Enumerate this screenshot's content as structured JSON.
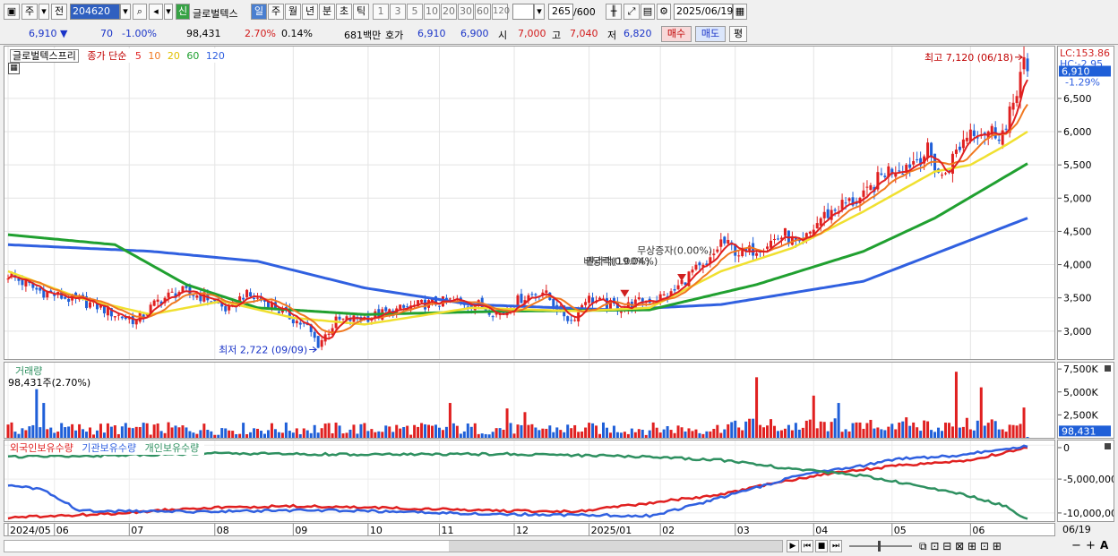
{
  "toolbar": {
    "market": "주",
    "market_prefix": "전",
    "code": "204620",
    "new_badge": "신",
    "stock_name": "글로벌텍스",
    "periods": [
      "일",
      "주",
      "월",
      "년",
      "분",
      "초",
      "틱"
    ],
    "active_period": "일",
    "intervals": [
      "1",
      "3",
      "5",
      "10",
      "20",
      "30",
      "60",
      "120"
    ],
    "count": "265",
    "count_total": "/600",
    "date": "2025/06/19"
  },
  "quote": {
    "price": "6,910",
    "arrow": "▼",
    "change": "70",
    "change_pct": "-1.00%",
    "volume": "98,431",
    "volume_pct": "2.70%",
    "turnover_pct": "0.14%",
    "amount": "681백만",
    "hoga_label": "호가",
    "ask": "6,910",
    "bid": "6,900",
    "open_label": "시",
    "open": "7,000",
    "high_label": "고",
    "high": "7,040",
    "low_label": "저",
    "low": "6,820",
    "buy_label": "매수",
    "sell_label": "매도",
    "eval_label": "평"
  },
  "chart_data": [
    {
      "type": "candlestick",
      "title": "글로벌텍스프리",
      "legend": {
        "price_type": "종가 단순",
        "ma_periods": [
          "5",
          "10",
          "20",
          "60",
          "120"
        ]
      },
      "colors": {
        "up": "#e02020",
        "down": "#1f5fd8",
        "ma5": "#e02020",
        "ma10": "#f07820",
        "ma20": "#f0e030",
        "ma60": "#20a030",
        "ma120": "#3060e0"
      },
      "x_tick_labels": [
        "2024/05",
        "06",
        "07",
        "08",
        "09",
        "10",
        "11",
        "12",
        "2025/01",
        "02",
        "03",
        "04",
        "05",
        "06"
      ],
      "x_end_label": "06/19",
      "y_ticks": [
        3000,
        3500,
        4000,
        4500,
        5000,
        5500,
        6000,
        6500
      ],
      "y_tick_labels": [
        "3,000",
        "3,500",
        "4,000",
        "4,500",
        "5,000",
        "5,500",
        "6,000",
        "6,500"
      ],
      "ylim": [
        2580,
        7280
      ],
      "right_labels": {
        "lc": "LC:153.86",
        "hc": "HC:-2.95",
        "current": "6,910",
        "current_pct": "-1.29%"
      },
      "annotations": {
        "max": "최고 7,120 (06/18)",
        "min": "최저 2,722 (09/09)",
        "events": [
          "배당락(0.00%)",
          "권리락(19.04%)",
          "무상증자(0.00%)"
        ]
      },
      "close_keypoints": [
        {
          "x": 0,
          "y": 3850
        },
        {
          "x": 8,
          "y": 3620
        },
        {
          "x": 16,
          "y": 3500
        },
        {
          "x": 24,
          "y": 3400
        },
        {
          "x": 30,
          "y": 3250
        },
        {
          "x": 36,
          "y": 3150
        },
        {
          "x": 42,
          "y": 3450
        },
        {
          "x": 48,
          "y": 3600
        },
        {
          "x": 56,
          "y": 3500
        },
        {
          "x": 62,
          "y": 3300
        },
        {
          "x": 66,
          "y": 3550
        },
        {
          "x": 72,
          "y": 3450
        },
        {
          "x": 78,
          "y": 3250
        },
        {
          "x": 84,
          "y": 3050
        },
        {
          "x": 87,
          "y": 2800
        },
        {
          "x": 92,
          "y": 3150
        },
        {
          "x": 100,
          "y": 3200
        },
        {
          "x": 108,
          "y": 3300
        },
        {
          "x": 116,
          "y": 3400
        },
        {
          "x": 124,
          "y": 3450
        },
        {
          "x": 132,
          "y": 3400
        },
        {
          "x": 138,
          "y": 3250
        },
        {
          "x": 144,
          "y": 3500
        },
        {
          "x": 150,
          "y": 3600
        },
        {
          "x": 154,
          "y": 3350
        },
        {
          "x": 158,
          "y": 3150
        },
        {
          "x": 162,
          "y": 3500
        },
        {
          "x": 168,
          "y": 3400
        },
        {
          "x": 172,
          "y": 3350
        },
        {
          "x": 178,
          "y": 3450
        },
        {
          "x": 186,
          "y": 3550
        },
        {
          "x": 192,
          "y": 3900
        },
        {
          "x": 196,
          "y": 3950
        },
        {
          "x": 200,
          "y": 4350
        },
        {
          "x": 206,
          "y": 4150
        },
        {
          "x": 212,
          "y": 4300
        },
        {
          "x": 218,
          "y": 4450
        },
        {
          "x": 222,
          "y": 4250
        },
        {
          "x": 228,
          "y": 4700
        },
        {
          "x": 234,
          "y": 4900
        },
        {
          "x": 240,
          "y": 5000
        },
        {
          "x": 246,
          "y": 5400
        },
        {
          "x": 252,
          "y": 5500
        },
        {
          "x": 258,
          "y": 5700
        },
        {
          "x": 262,
          "y": 5300
        },
        {
          "x": 266,
          "y": 5700
        },
        {
          "x": 270,
          "y": 6050
        },
        {
          "x": 276,
          "y": 6000
        },
        {
          "x": 280,
          "y": 6000
        },
        {
          "x": 284,
          "y": 6900
        },
        {
          "x": 285,
          "y": 7120
        },
        {
          "x": 286,
          "y": 6910
        }
      ],
      "ma_keypoints": {
        "ma20": [
          {
            "x": 0,
            "y": 3900
          },
          {
            "x": 20,
            "y": 3500
          },
          {
            "x": 40,
            "y": 3250
          },
          {
            "x": 60,
            "y": 3450
          },
          {
            "x": 80,
            "y": 3200
          },
          {
            "x": 100,
            "y": 3100
          },
          {
            "x": 130,
            "y": 3350
          },
          {
            "x": 160,
            "y": 3300
          },
          {
            "x": 180,
            "y": 3350
          },
          {
            "x": 200,
            "y": 3900
          },
          {
            "x": 220,
            "y": 4250
          },
          {
            "x": 240,
            "y": 4800
          },
          {
            "x": 260,
            "y": 5400
          },
          {
            "x": 270,
            "y": 5500
          },
          {
            "x": 280,
            "y": 5800
          },
          {
            "x": 286,
            "y": 6000
          }
        ],
        "ma60": [
          {
            "x": 0,
            "y": 4450
          },
          {
            "x": 30,
            "y": 4300
          },
          {
            "x": 50,
            "y": 3700
          },
          {
            "x": 70,
            "y": 3350
          },
          {
            "x": 100,
            "y": 3250
          },
          {
            "x": 140,
            "y": 3300
          },
          {
            "x": 180,
            "y": 3320
          },
          {
            "x": 210,
            "y": 3700
          },
          {
            "x": 240,
            "y": 4200
          },
          {
            "x": 260,
            "y": 4700
          },
          {
            "x": 286,
            "y": 5520
          }
        ],
        "ma120": [
          {
            "x": 0,
            "y": 4300
          },
          {
            "x": 40,
            "y": 4200
          },
          {
            "x": 70,
            "y": 4050
          },
          {
            "x": 100,
            "y": 3650
          },
          {
            "x": 130,
            "y": 3400
          },
          {
            "x": 170,
            "y": 3320
          },
          {
            "x": 200,
            "y": 3400
          },
          {
            "x": 240,
            "y": 3750
          },
          {
            "x": 286,
            "y": 4700
          }
        ]
      }
    },
    {
      "type": "bar",
      "title": "거래량",
      "current_label": "98,431주(2.70%)",
      "y_tick_labels": [
        "7,500K",
        "5,000K",
        "2,500K"
      ],
      "ylim": [
        0,
        8000000
      ],
      "right_labels": {
        "current": "98,431",
        "pct": "2.70%"
      },
      "spikes": [
        {
          "x": 8,
          "v": 5300000
        },
        {
          "x": 10,
          "v": 3800000
        },
        {
          "x": 124,
          "v": 3800000
        },
        {
          "x": 140,
          "v": 3200000
        },
        {
          "x": 145,
          "v": 2800000
        },
        {
          "x": 210,
          "v": 6600000
        },
        {
          "x": 226,
          "v": 4600000
        },
        {
          "x": 233,
          "v": 3800000
        },
        {
          "x": 266,
          "v": 7200000
        },
        {
          "x": 273,
          "v": 5500000
        },
        {
          "x": 285,
          "v": 3300000
        },
        {
          "x": 286,
          "v": 98431
        }
      ]
    },
    {
      "type": "line",
      "legend": [
        "외국인보유수량",
        "기관보유수량",
        "개인보유수량"
      ],
      "y_tick_labels": [
        "0",
        "-5,000,000",
        "-10,000,000"
      ],
      "ylim": [
        -11200000,
        700000
      ],
      "series": [
        {
          "name": "외국인보유수량",
          "color": "#e02020",
          "points": [
            {
              "x": 0,
              "y": -10700000
            },
            {
              "x": 30,
              "y": -10100000
            },
            {
              "x": 50,
              "y": -9300000
            },
            {
              "x": 80,
              "y": -9000000
            },
            {
              "x": 110,
              "y": -9300000
            },
            {
              "x": 140,
              "y": -9700000
            },
            {
              "x": 160,
              "y": -9800000
            },
            {
              "x": 180,
              "y": -8500000
            },
            {
              "x": 200,
              "y": -7300000
            },
            {
              "x": 215,
              "y": -5600000
            },
            {
              "x": 230,
              "y": -4200000
            },
            {
              "x": 250,
              "y": -3000000
            },
            {
              "x": 270,
              "y": -2200000
            },
            {
              "x": 286,
              "y": -300000
            }
          ]
        },
        {
          "name": "기관보유수량",
          "color": "#3060e0",
          "points": [
            {
              "x": 0,
              "y": -6000000
            },
            {
              "x": 10,
              "y": -6500000
            },
            {
              "x": 20,
              "y": -9700000
            },
            {
              "x": 50,
              "y": -9800000
            },
            {
              "x": 90,
              "y": -9600000
            },
            {
              "x": 140,
              "y": -10200000
            },
            {
              "x": 180,
              "y": -10400000
            },
            {
              "x": 190,
              "y": -9200000
            },
            {
              "x": 205,
              "y": -7000000
            },
            {
              "x": 225,
              "y": -4000000
            },
            {
              "x": 240,
              "y": -3000000
            },
            {
              "x": 250,
              "y": -2000000
            },
            {
              "x": 265,
              "y": -1600000
            },
            {
              "x": 286,
              "y": -100000
            }
          ]
        },
        {
          "name": "개인보유수량",
          "color": "#2e9060",
          "points": [
            {
              "x": 0,
              "y": -1700000
            },
            {
              "x": 30,
              "y": -1500000
            },
            {
              "x": 60,
              "y": -1200000
            },
            {
              "x": 100,
              "y": -1400000
            },
            {
              "x": 140,
              "y": -1300000
            },
            {
              "x": 180,
              "y": -1700000
            },
            {
              "x": 200,
              "y": -2200000
            },
            {
              "x": 220,
              "y": -3500000
            },
            {
              "x": 240,
              "y": -4500000
            },
            {
              "x": 255,
              "y": -6000000
            },
            {
              "x": 270,
              "y": -7500000
            },
            {
              "x": 280,
              "y": -9000000
            },
            {
              "x": 286,
              "y": -11000000
            }
          ]
        }
      ]
    }
  ]
}
